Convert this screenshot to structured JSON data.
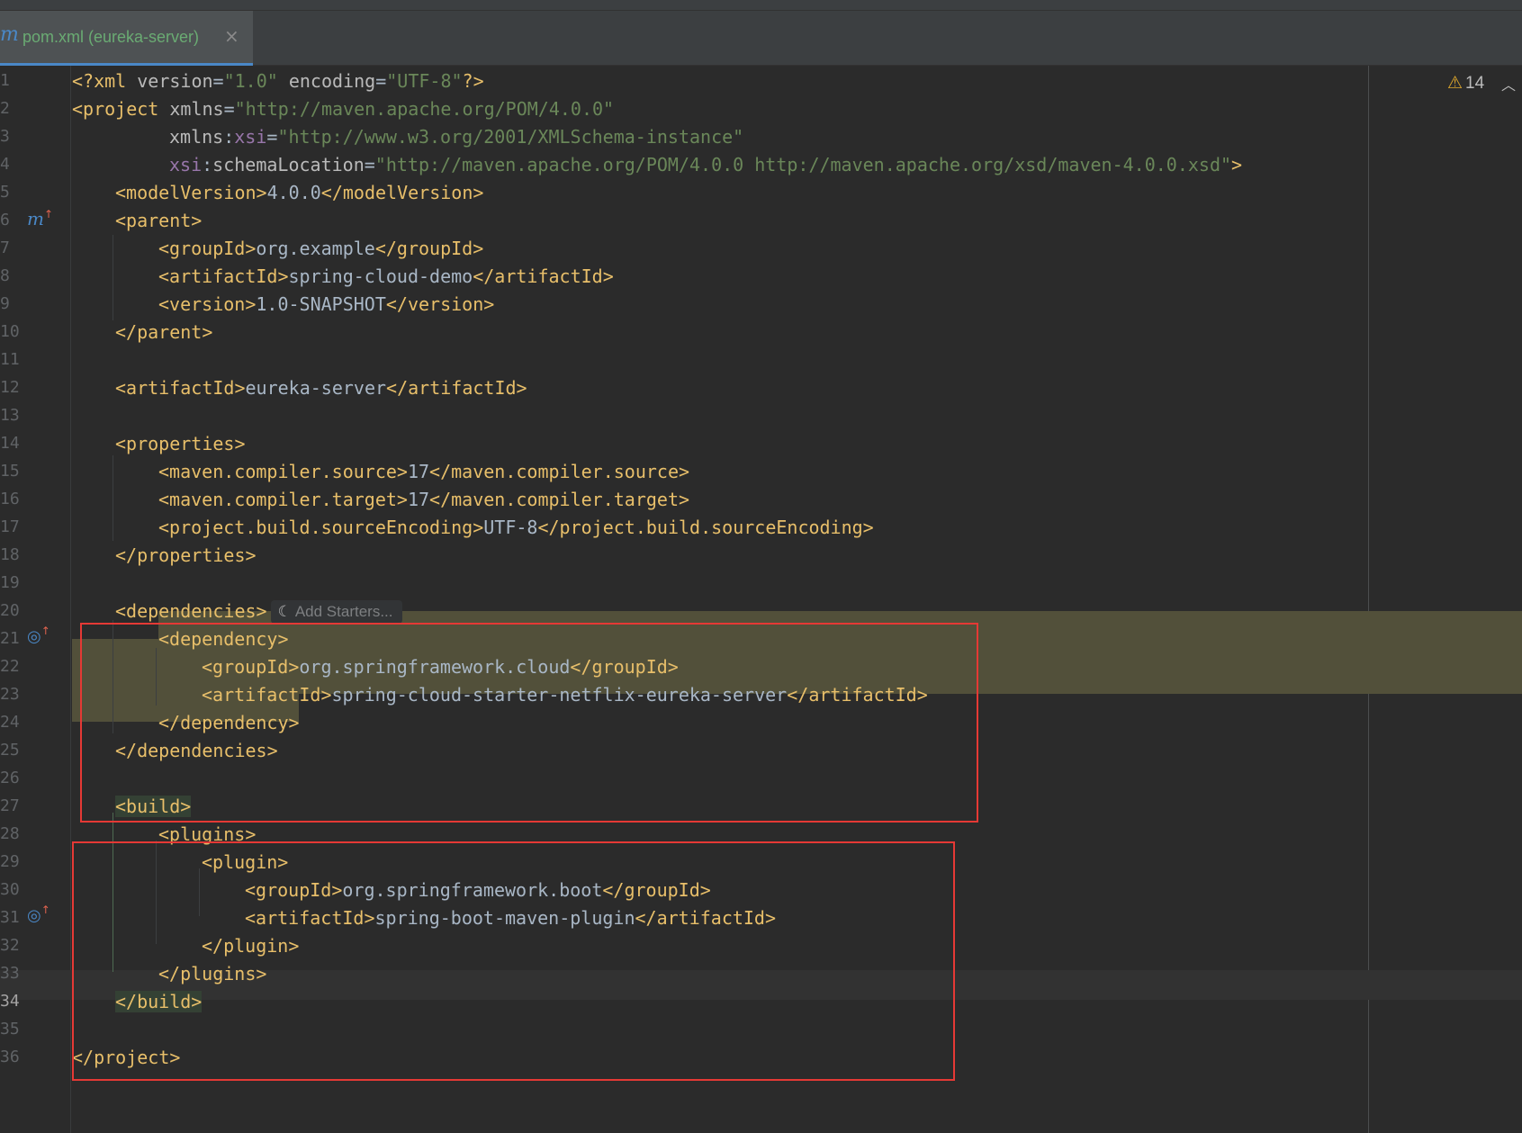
{
  "tab": {
    "icon": "maven-m-icon",
    "title": "pom.xml (eureka-server)",
    "close": "×"
  },
  "inspections": {
    "warning_count": "14",
    "icon": "warning-triangle-icon",
    "collapse": "chevron-up-icon"
  },
  "inlay": {
    "add_starters": "Add Starters...",
    "icon": "spring-leaf-icon"
  },
  "lines": [
    {
      "n": "1"
    },
    {
      "n": "2"
    },
    {
      "n": "3"
    },
    {
      "n": "4"
    },
    {
      "n": "5"
    },
    {
      "n": "6",
      "gutter_icon": "maven-parent-icon"
    },
    {
      "n": "7"
    },
    {
      "n": "8"
    },
    {
      "n": "9"
    },
    {
      "n": "10"
    },
    {
      "n": "11"
    },
    {
      "n": "12"
    },
    {
      "n": "13"
    },
    {
      "n": "14"
    },
    {
      "n": "15"
    },
    {
      "n": "16"
    },
    {
      "n": "17"
    },
    {
      "n": "18"
    },
    {
      "n": "19"
    },
    {
      "n": "20"
    },
    {
      "n": "21",
      "gutter_icon": "dependency-target-icon"
    },
    {
      "n": "22"
    },
    {
      "n": "23"
    },
    {
      "n": "24"
    },
    {
      "n": "25"
    },
    {
      "n": "26"
    },
    {
      "n": "27"
    },
    {
      "n": "28"
    },
    {
      "n": "29"
    },
    {
      "n": "30"
    },
    {
      "n": "31",
      "gutter_icon": "dependency-target-icon"
    },
    {
      "n": "32"
    },
    {
      "n": "33"
    },
    {
      "n": "34",
      "current": true
    },
    {
      "n": "35"
    },
    {
      "n": "36"
    }
  ],
  "code": {
    "l1": [
      "<?xml ",
      "version",
      "=",
      "\"1.0\"",
      " encoding",
      "=",
      "\"UTF-8\"",
      "?>"
    ],
    "l2": [
      "<project ",
      "xmlns",
      "=",
      "\"http://maven.apache.org/POM/4.0.0\""
    ],
    "l3": [
      "xmlns",
      ":",
      "xsi",
      "=",
      "\"http://www.w3.org/2001/XMLSchema-instance\""
    ],
    "l4": [
      "xsi",
      ":",
      "schemaLocation",
      "=",
      "\"http://maven.apache.org/POM/4.0.0 http://maven.apache.org/xsd/maven-4.0.0.xsd\"",
      ">"
    ],
    "l5": [
      "<modelVersion>",
      "4.0.0",
      "</modelVersion>"
    ],
    "l6": [
      "<parent>"
    ],
    "l7": [
      "<groupId>",
      "org.example",
      "</groupId>"
    ],
    "l8": [
      "<artifactId>",
      "spring-cloud-demo",
      "</artifactId>"
    ],
    "l9": [
      "<version>",
      "1.0-SNAPSHOT",
      "</version>"
    ],
    "l10": [
      "</parent>"
    ],
    "l12": [
      "<artifactId>",
      "eureka-server",
      "</artifactId>"
    ],
    "l14": [
      "<properties>"
    ],
    "l15": [
      "<maven.compiler.source>",
      "17",
      "</maven.compiler.source>"
    ],
    "l16": [
      "<maven.compiler.target>",
      "17",
      "</maven.compiler.target>"
    ],
    "l17": [
      "<project.build.sourceEncoding>",
      "UTF-8",
      "</project.build.sourceEncoding>"
    ],
    "l18": [
      "</properties>"
    ],
    "l20": [
      "<dependencies>"
    ],
    "l21": [
      "<dependency>"
    ],
    "l22": [
      "<groupId>",
      "org.springframework.cloud",
      "</groupId>"
    ],
    "l23": [
      "<artifactId>",
      "spring-cloud-starter-netflix-eureka-server",
      "</artifactId>"
    ],
    "l24": [
      "</dependency>"
    ],
    "l25": [
      "</dependencies>"
    ],
    "l27": [
      "<build>"
    ],
    "l28": [
      "<plugins>"
    ],
    "l29": [
      "<plugin>"
    ],
    "l30": [
      "<groupId>",
      "org.springframework.boot",
      "</groupId>"
    ],
    "l31": [
      "<artifactId>",
      "spring-boot-maven-plugin",
      "</artifactId>"
    ],
    "l32": [
      "</plugin>"
    ],
    "l33": [
      "</plugins>"
    ],
    "l34": [
      "</build>"
    ],
    "l36": [
      "</project>"
    ]
  },
  "colors": {
    "tag": "#e8bf6a",
    "attribute": "#bababa",
    "value": "#6a8759",
    "namespace": "#9876aa",
    "text": "#a9b7c6",
    "annotation_box": "#e53935",
    "tab_title": "#6aab73"
  }
}
